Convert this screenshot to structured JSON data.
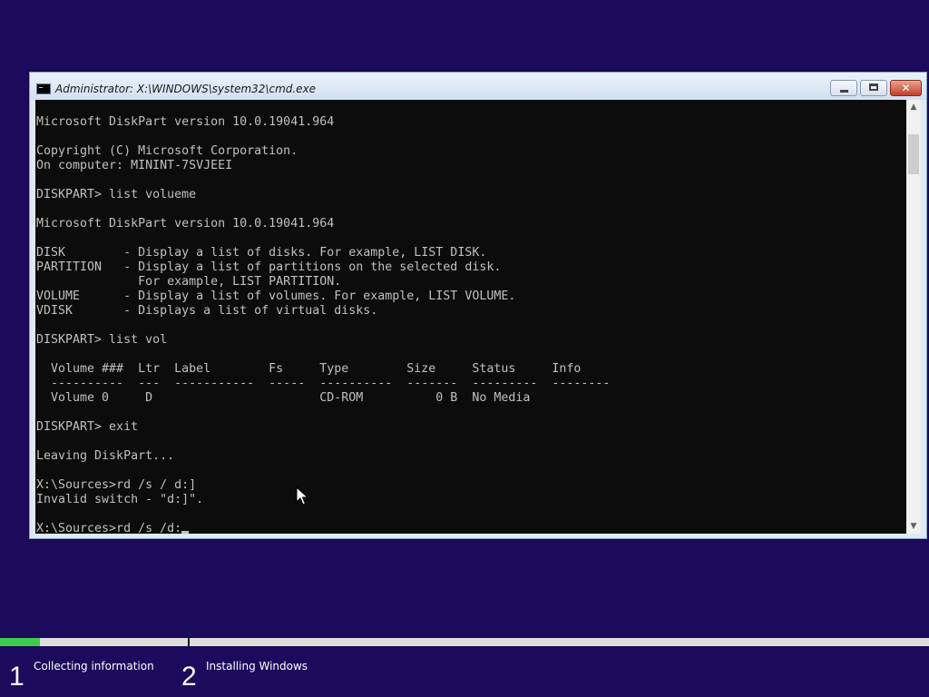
{
  "window": {
    "title": "Administrator: X:\\WINDOWS\\system32\\cmd.exe",
    "icon": "console-icon",
    "buttons": {
      "minimize": "minimize-icon",
      "maximize": "maximize-icon",
      "close": "close-icon",
      "close_glyph": "✕"
    }
  },
  "console": {
    "lines": [
      "Microsoft DiskPart version 10.0.19041.964",
      "",
      "Copyright (C) Microsoft Corporation.",
      "On computer: MININT-7SVJEEI",
      "",
      "DISKPART> list volueme",
      "",
      "Microsoft DiskPart version 10.0.19041.964",
      "",
      "DISK        - Display a list of disks. For example, LIST DISK.",
      "PARTITION   - Display a list of partitions on the selected disk.",
      "              For example, LIST PARTITION.",
      "VOLUME      - Display a list of volumes. For example, LIST VOLUME.",
      "VDISK       - Displays a list of virtual disks.",
      "",
      "DISKPART> list vol",
      "",
      "  Volume ###  Ltr  Label        Fs     Type        Size     Status     Info",
      "  ----------  ---  -----------  -----  ----------  -------  ---------  --------",
      "  Volume 0     D                       CD-ROM          0 B  No Media",
      "",
      "DISKPART> exit",
      "",
      "Leaving DiskPart...",
      "",
      "X:\\Sources>rd /s / d:]",
      "Invalid switch - \"d:]\".",
      "",
      "X:\\Sources>rd /s /d:"
    ]
  },
  "scrollbar": {
    "up_arrow": "▲",
    "down_arrow": "▼"
  },
  "setup": {
    "progress": 0.043,
    "steps": [
      {
        "number": "1",
        "label": "Collecting information"
      },
      {
        "number": "2",
        "label": "Installing Windows"
      }
    ],
    "colors": {
      "background": "#1c0a5c",
      "progress": "#3fcc4a"
    }
  }
}
